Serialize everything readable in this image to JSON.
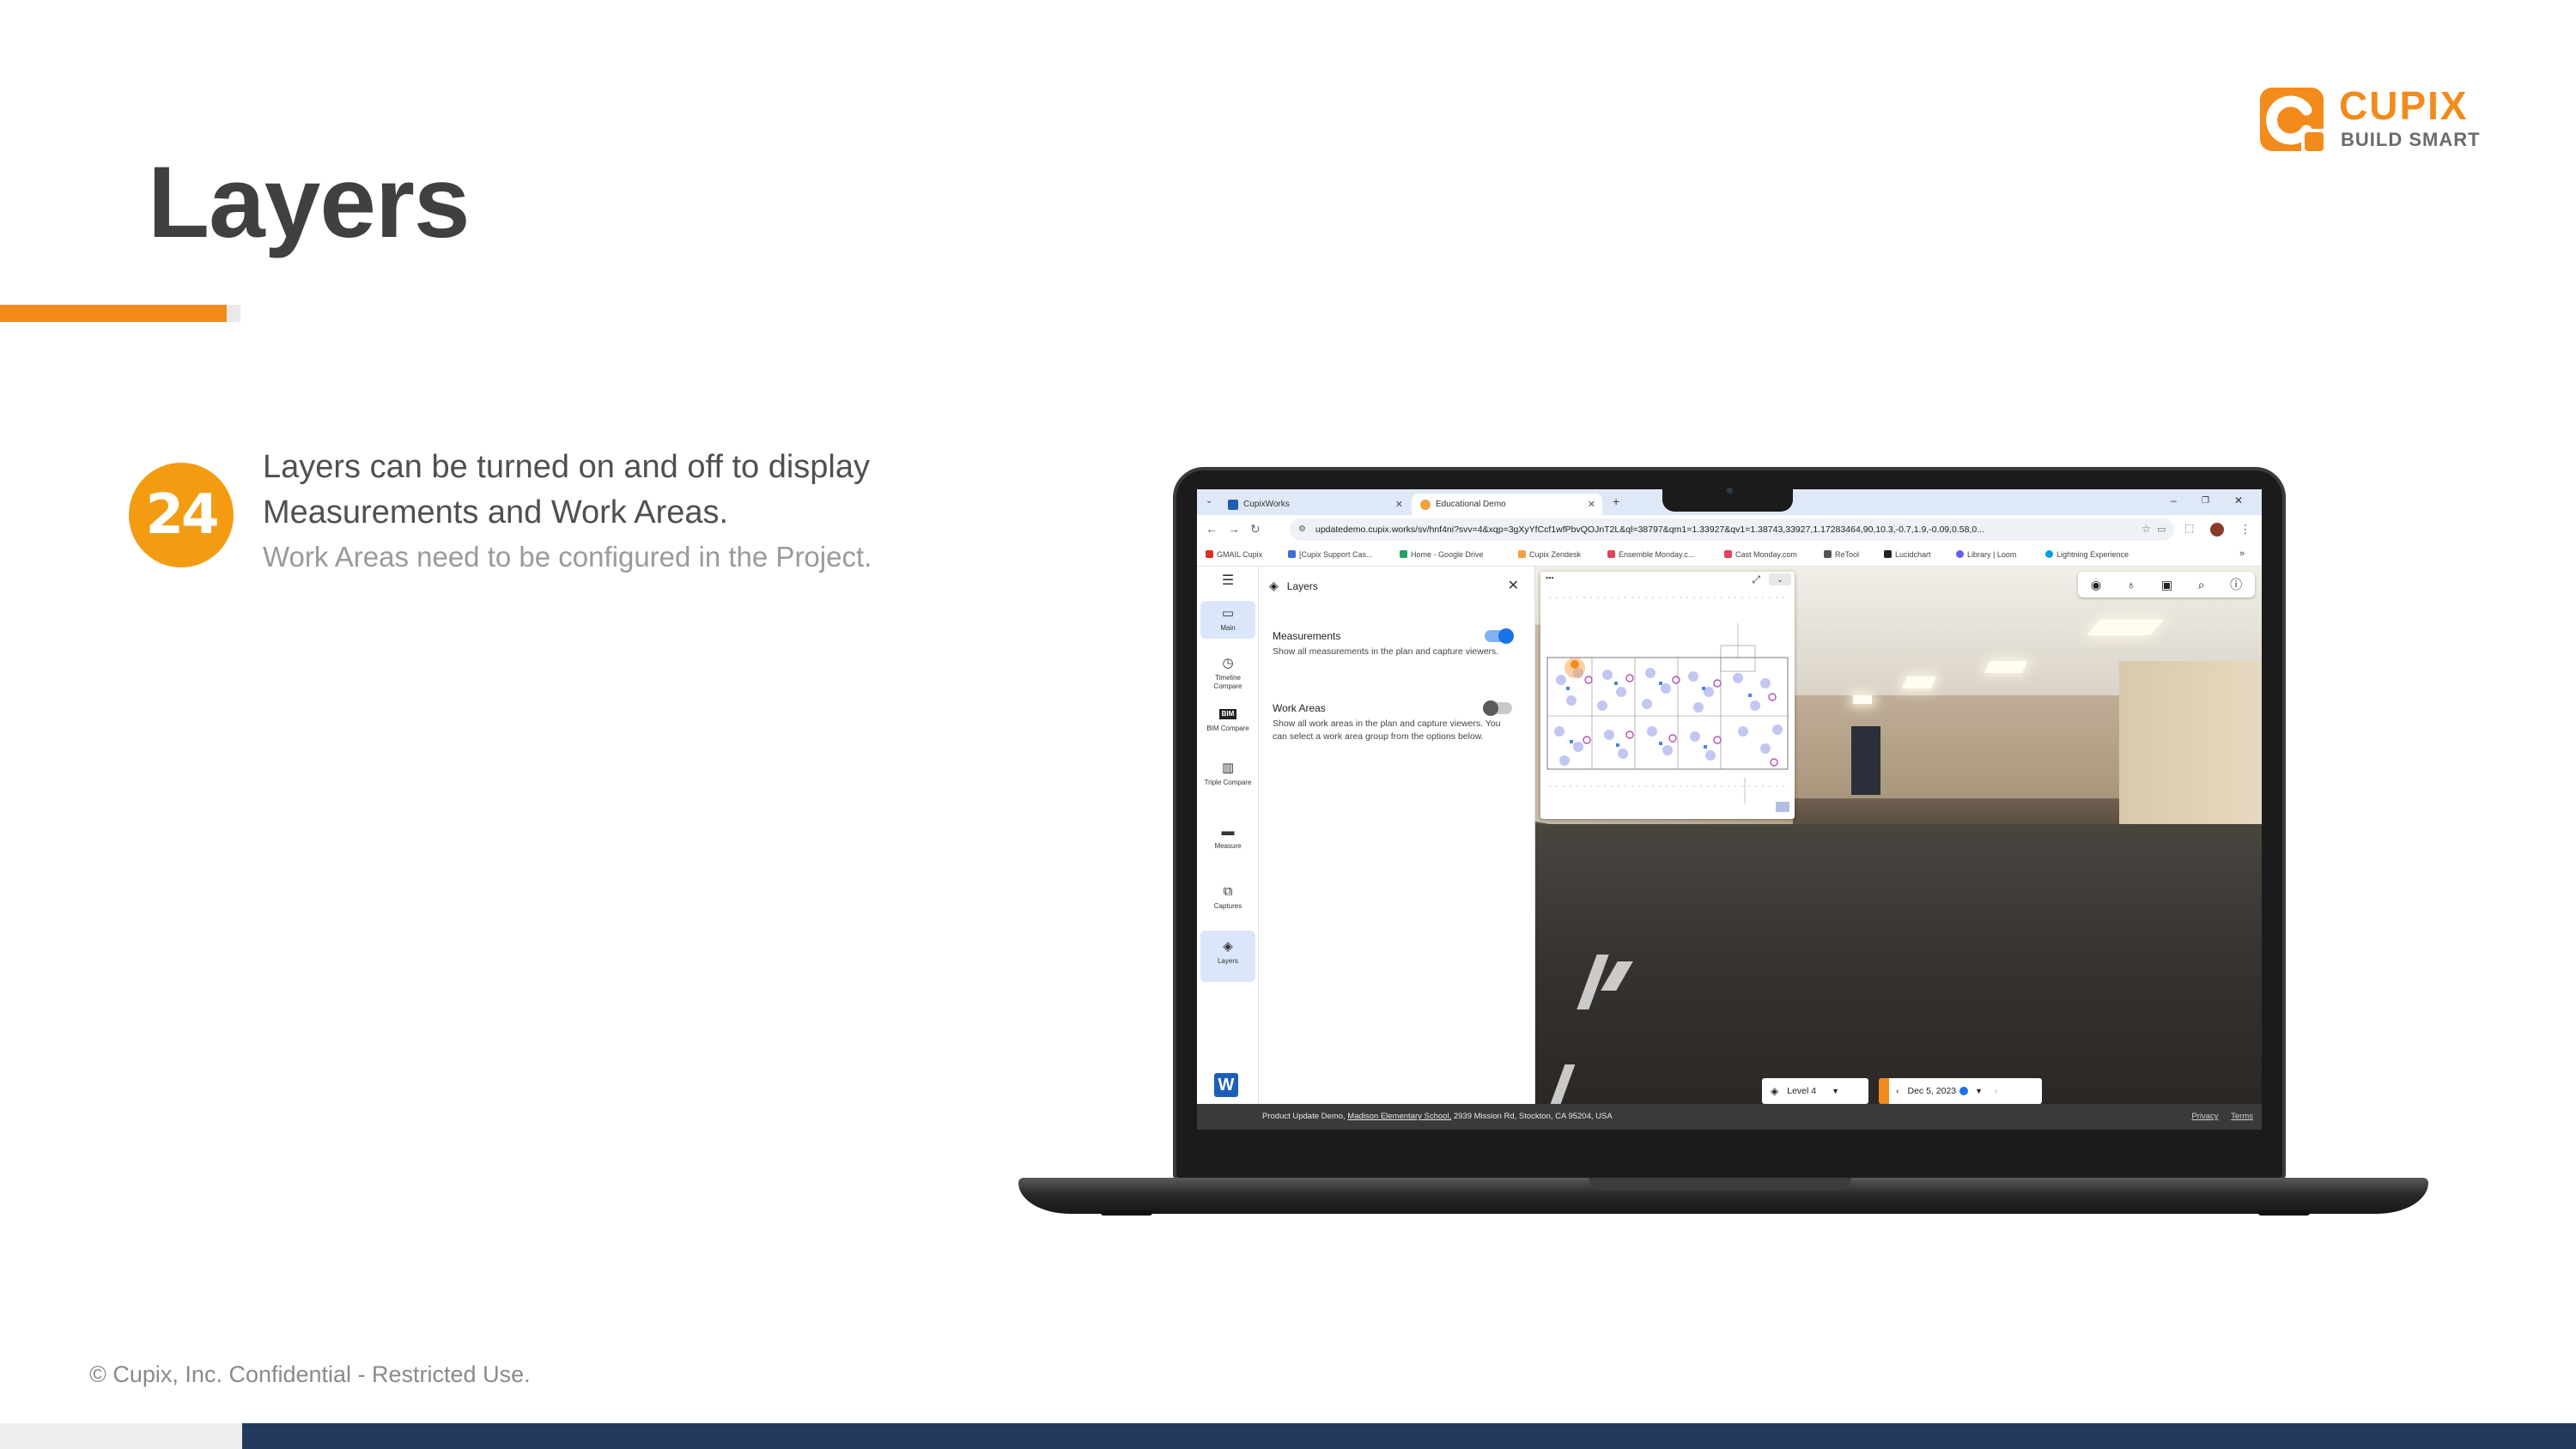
{
  "slide": {
    "title": "Layers",
    "step_number": "24",
    "step_text": "Layers can be turned on and off to display Measurements and Work Areas.",
    "step_subtext": "Work Areas need to be configured in the Project.",
    "footer": "© Cupix, Inc. Confidential - Restricted Use.",
    "logo": {
      "word": "CUPIX",
      "tagline": "BUILD SMART"
    },
    "accent_color": "#f28b1c",
    "footer_color": "#213a5c"
  },
  "browser": {
    "tabs": [
      {
        "label": "CupixWorks",
        "active": false
      },
      {
        "label": "Educational Demo",
        "active": true
      }
    ],
    "new_tab_label": "+",
    "url": "updatedemo.cupix.works/sv/hnf4ni?svv=4&xqp=3gXyYfCcf1wfPbvQOJnT2L&ql=38797&qm1=1.33927&qv1=1.38743,33927,1.17283464,90,10.3,-0.7,1.9,-0.09,0.58,0...",
    "bookmarks": [
      "GMAIL Cupix",
      "[Cupix Support Cas...",
      "Home - Google Drive",
      "Cupix Zendesk",
      "Ensemble Monday.c...",
      "Cast Monday.com",
      "ReTool",
      "Lucidchart",
      "Library | Loom",
      "Lightning Experience"
    ],
    "bookmarks_more": "»"
  },
  "app": {
    "rail": [
      {
        "label": "Main",
        "icon": "square-icon",
        "active": true
      },
      {
        "label": "Timeline Compare",
        "icon": "clock-icon",
        "active": false
      },
      {
        "label": "BIM Compare",
        "icon": "bim-icon",
        "active": false
      },
      {
        "label": "Triple Compare",
        "icon": "grid-icon",
        "active": false
      },
      {
        "label": "Measure",
        "icon": "ruler-icon",
        "active": false
      },
      {
        "label": "Captures",
        "icon": "captures-icon",
        "active": false
      },
      {
        "label": "Layers",
        "icon": "layers-icon",
        "active": true
      }
    ],
    "rail_logo": "W",
    "panel": {
      "title": "Layers",
      "options": [
        {
          "title": "Measurements",
          "description": "Show all measurements in the plan and capture viewers.",
          "enabled": true
        },
        {
          "title": "Work Areas",
          "description": "Show all work areas in the plan and capture viewers. You can select a work area group from the options below.",
          "enabled": false
        }
      ]
    },
    "viewer": {
      "level": "Level 4",
      "date": "Dec 5, 2023",
      "tools": [
        "eye-icon",
        "bulb-icon",
        "camera-icon",
        "zoom-icon",
        "info-icon"
      ]
    },
    "status": {
      "prefix": "Product Update Demo,",
      "school": "Madison Elementary School,",
      "address": "2939 Mission Rd, Stockton, CA 95204, USA",
      "links": [
        "Privacy",
        "Terms"
      ]
    }
  }
}
